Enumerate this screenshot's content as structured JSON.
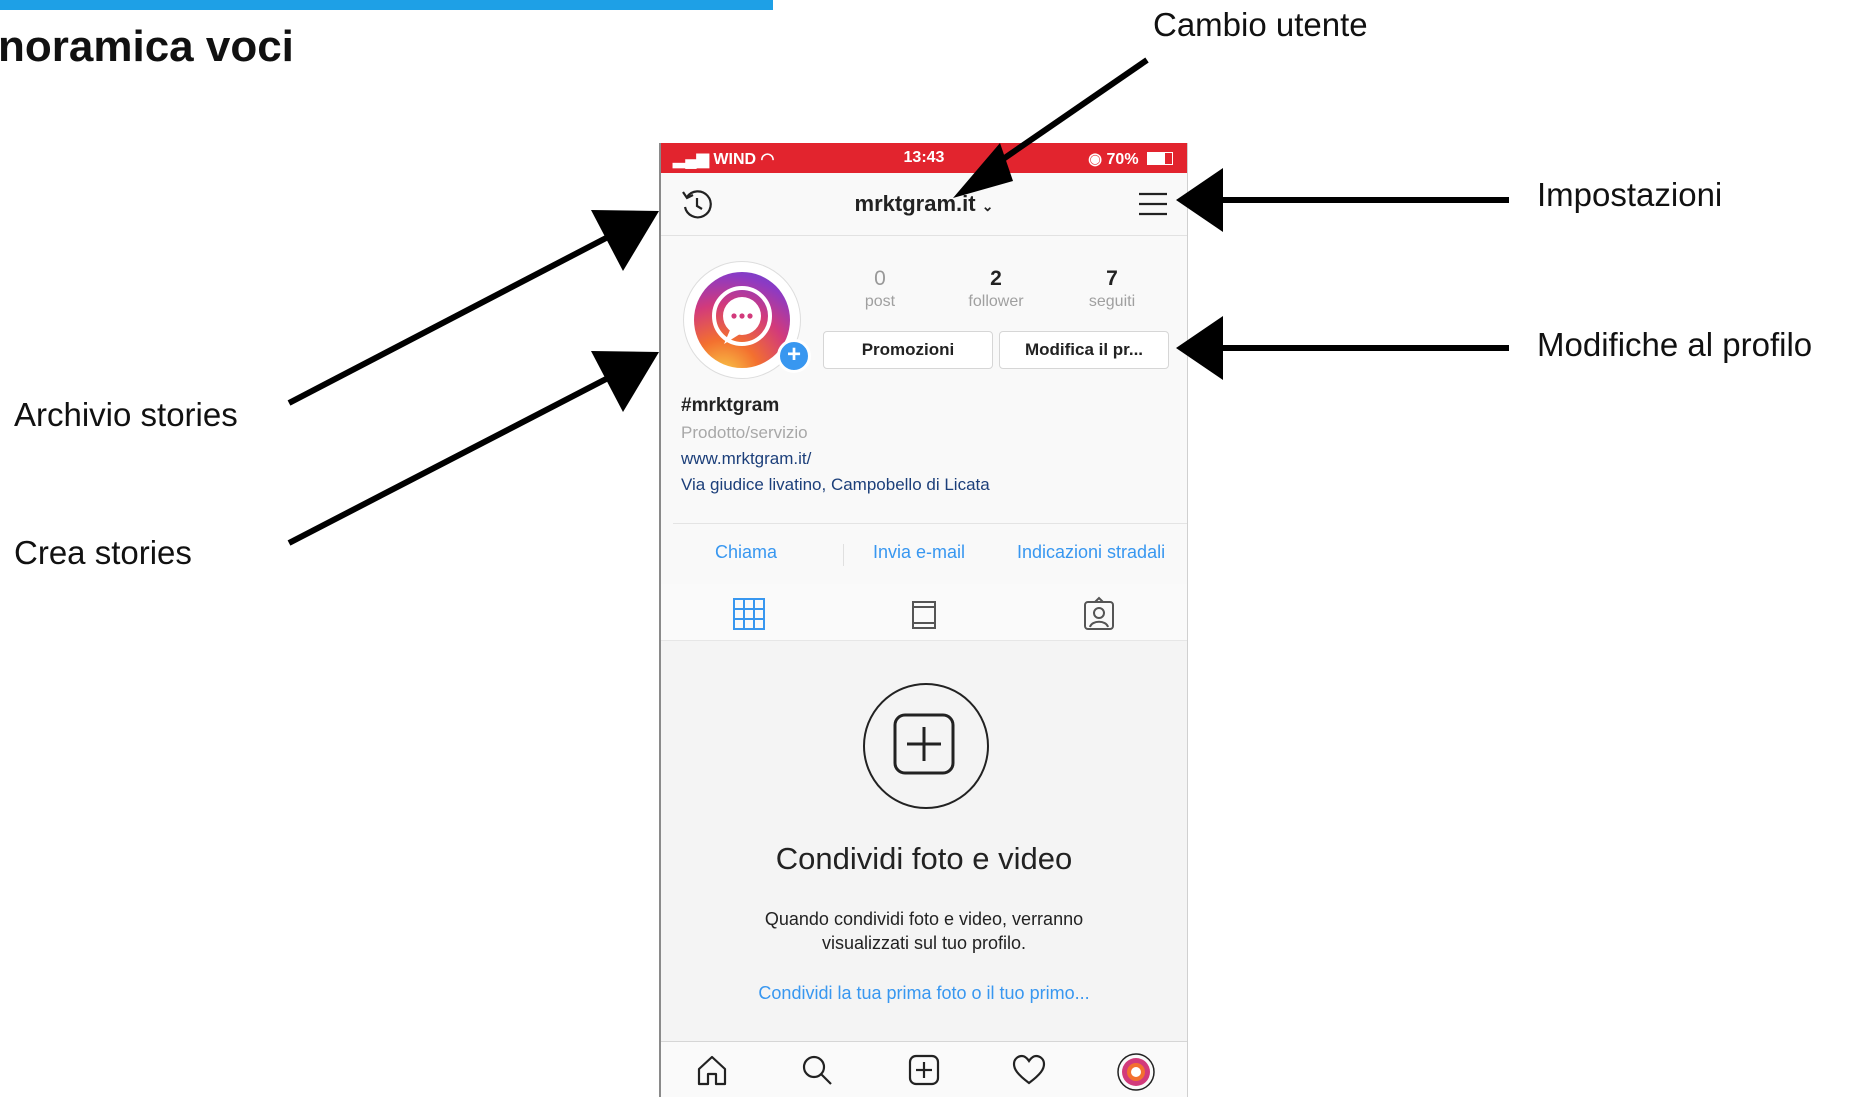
{
  "slide": {
    "title": "noramica voci",
    "accent_color": "#1ea0e6"
  },
  "annotations": {
    "cambio_utente": "Cambio utente",
    "impostazioni": "Impostazioni",
    "modifiche_profilo": "Modifiche al profilo",
    "archivio_stories": "Archivio stories",
    "crea_stories": "Crea stories"
  },
  "status_bar": {
    "carrier": "WIND",
    "time": "13:43",
    "battery": "70%",
    "color": "#e2242e"
  },
  "header": {
    "username": "mrktgram.it",
    "left_icon": "history-icon",
    "right_icon": "hamburger-menu-icon"
  },
  "profile": {
    "stats": [
      {
        "count": "0",
        "label": "post"
      },
      {
        "count": "2",
        "label": "follower"
      },
      {
        "count": "7",
        "label": "seguiti"
      }
    ],
    "buttons": {
      "promotions": "Promozioni",
      "edit": "Modifica il pr..."
    },
    "bio": {
      "name": "#mrktgram",
      "category": "Prodotto/servizio",
      "url": "www.mrktgram.it/",
      "address": "Via giudice livatino, Campobello di Licata"
    },
    "contact_buttons": [
      "Chiama",
      "Invia e-mail",
      "Indicazioni stradali"
    ]
  },
  "tabs": [
    "grid-icon",
    "feed-icon",
    "tagged-icon"
  ],
  "empty_state": {
    "title": "Condividi foto e video",
    "text": "Quando condividi foto e video, verranno visualizzati sul tuo profilo.",
    "link": "Condividi la tua prima foto o il tuo primo..."
  },
  "bottom_nav": [
    "home-icon",
    "search-icon",
    "add-post-icon",
    "heart-icon",
    "profile-icon"
  ],
  "colors": {
    "link_blue": "#3897f0",
    "badge_blue": "#3897f0"
  }
}
